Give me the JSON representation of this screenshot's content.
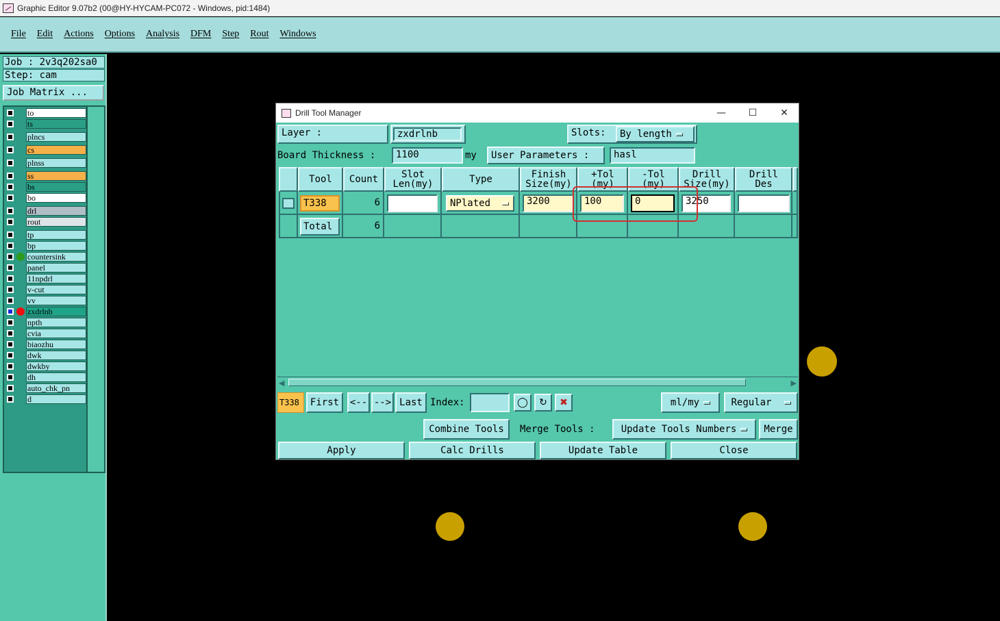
{
  "window": {
    "title": "Graphic Editor 9.07b2 (00@HY-HYCAM-PC072 - Windows, pid:1484)"
  },
  "menu": [
    "File",
    "Edit",
    "Actions",
    "Options",
    "Analysis",
    "DFM",
    "Step",
    "Rout",
    "Windows"
  ],
  "left_panel": {
    "job": "Job : 2v3q202sa0",
    "step": "Step: cam",
    "job_matrix": "Job Matrix ..."
  },
  "layers": [
    {
      "name": "to",
      "color": "#ffffff"
    },
    {
      "name": "ts",
      "color": "#2a9f86"
    },
    {
      "name": "plncs",
      "color": "#a7e6e6"
    },
    {
      "name": "cs",
      "color": "#f5b04a"
    },
    {
      "name": "plnss",
      "color": "#a7e6e6"
    },
    {
      "name": "ss",
      "color": "#f5b04a"
    },
    {
      "name": "bs",
      "color": "#2a9f86"
    },
    {
      "name": "bo",
      "color": "#ffffff"
    },
    {
      "name": "drl",
      "color": "#b0bec5"
    },
    {
      "name": "rout",
      "color": "#dde5e8"
    },
    {
      "name": "tp",
      "color": "#a7e6e6"
    },
    {
      "name": "bp",
      "color": "#a7e6e6"
    },
    {
      "name": "countersink",
      "color": "#a7e6e6",
      "dot": "#2e9a1e"
    },
    {
      "name": "panel",
      "color": "#a7e6e6"
    },
    {
      "name": "11npdrl",
      "color": "#a7e6e6"
    },
    {
      "name": "v-cut",
      "color": "#a7e6e6"
    },
    {
      "name": "vv",
      "color": "#a7e6e6"
    },
    {
      "name": "zxdrlnb",
      "color": "#1fa489",
      "dot": "#ee1010",
      "selected": true
    },
    {
      "name": "npth",
      "color": "#a7e6e6"
    },
    {
      "name": "cvia",
      "color": "#a7e6e6"
    },
    {
      "name": "biaozhu",
      "color": "#a7e6e6"
    },
    {
      "name": "dwk",
      "color": "#a7e6e6"
    },
    {
      "name": "dwkby",
      "color": "#a7e6e6"
    },
    {
      "name": "dh",
      "color": "#a7e6e6"
    },
    {
      "name": "auto_chk_pn",
      "color": "#a7e6e6"
    },
    {
      "name": "d",
      "color": "#a7e6e6"
    }
  ],
  "dialog": {
    "title": "Drill Tool Manager",
    "layer_label": "Layer           :",
    "layer_value": "zxdrlnb",
    "slots_label": "Slots:",
    "slots_value": "By length",
    "board_thickness_label": "Board Thickness :",
    "board_thickness_value": "1100",
    "board_thickness_unit": "my",
    "user_params_label": "User Parameters :",
    "user_params_value": "hasl",
    "table": {
      "headers": [
        "Tool",
        "Count",
        "Slot\nLen(my)",
        "Type",
        "Finish\nSize(my)",
        "+Tol\n(my)",
        "-Tol\n(my)",
        "Drill\nSize(my)",
        "Drill\nDes"
      ],
      "row": {
        "tool": "T338",
        "count": "6",
        "slot_len": "",
        "type": "NPlated",
        "finish_size": "3200",
        "plus_tol": "100",
        "minus_tol": "0",
        "drill_size": "3250",
        "drill_des": ""
      },
      "total_label": "Total",
      "total_count": "6"
    },
    "nav": {
      "current_tool": "T338",
      "first": "First",
      "prev": "<--",
      "next": "-->",
      "last": "Last",
      "index_label": "Index:",
      "index_value": "",
      "units": "ml/my",
      "mode": "Regular"
    },
    "merge": {
      "combine_tools": "Combine Tools",
      "merge_tools_label": "Merge Tools   :",
      "merge_option": "Update Tools Numbers",
      "merge_button": "Merge"
    },
    "actions": {
      "apply": "Apply",
      "calc_drills": "Calc Drills",
      "update_table": "Update Table",
      "close": "Close"
    }
  },
  "colors": {
    "menu_bg": "#a6dcdc",
    "panel_bg": "#55c7ab",
    "widget_bg": "#a7e6e6",
    "tool_highlight": "#f9c24d",
    "pad": "#c8a000",
    "highlight_box": "#d03030"
  }
}
